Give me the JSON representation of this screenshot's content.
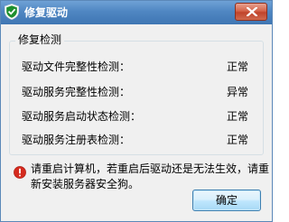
{
  "window": {
    "title": "修复驱动",
    "app_icon": "shield-check-icon",
    "close_icon": "close-icon"
  },
  "group": {
    "title": "修复检测"
  },
  "checks": [
    {
      "label": "驱动文件完整性检测：",
      "status": "正常"
    },
    {
      "label": "驱动服务完整性检测：",
      "status": "异常"
    },
    {
      "label": "驱动服务启动状态检测：",
      "status": "正常"
    },
    {
      "label": "驱动服务注册表检测：",
      "status": "正常"
    }
  ],
  "message": {
    "icon": "warning-icon",
    "text": "请重启计算机，若重启后驱动还是无法生效，请重新安装服务器安全狗。"
  },
  "buttons": {
    "ok_label": "确定"
  },
  "colors": {
    "title_bar": "#4f86c2",
    "close_button": "#c0432a",
    "warning": "#d42a1e",
    "app_icon": "#1e8f2e"
  }
}
